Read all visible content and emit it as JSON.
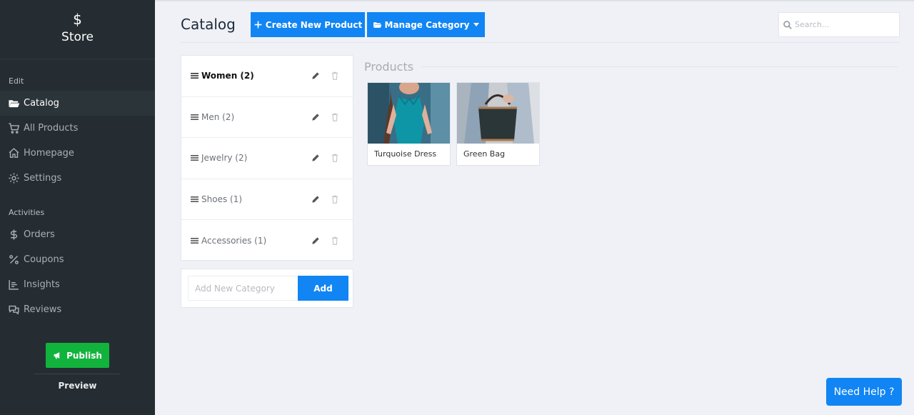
{
  "sidebar": {
    "brand_icon": "$",
    "brand_name": "Store",
    "edit_label": "Edit",
    "edit_items": [
      {
        "label": "Catalog",
        "icon": "folder-open-icon"
      },
      {
        "label": "All Products",
        "icon": "cart-icon"
      },
      {
        "label": "Homepage",
        "icon": "home-icon"
      },
      {
        "label": "Settings",
        "icon": "gear-icon"
      }
    ],
    "activities_label": "Activities",
    "activity_items": [
      {
        "label": "Orders",
        "icon": "dollar-icon"
      },
      {
        "label": "Coupons",
        "icon": "percent-icon"
      },
      {
        "label": "Insights",
        "icon": "bar-chart-icon"
      },
      {
        "label": "Reviews",
        "icon": "comments-icon"
      }
    ],
    "publish_label": "Publish",
    "preview_label": "Preview"
  },
  "header": {
    "title": "Catalog",
    "create_label": "Create New Product",
    "manage_label": "Manage Category",
    "search_placeholder": "Search..."
  },
  "categories": [
    {
      "label": "Women (2)",
      "active": true
    },
    {
      "label": "Men (2)",
      "active": false
    },
    {
      "label": "Jewelry (2)",
      "active": false
    },
    {
      "label": "Shoes (1)",
      "active": false
    },
    {
      "label": "Accessories (1)",
      "active": false
    }
  ],
  "add_category": {
    "placeholder": "Add New Category",
    "button_label": "Add"
  },
  "products": {
    "heading": "Products",
    "items": [
      {
        "name": "Turquoise Dress"
      },
      {
        "name": "Green Bag"
      }
    ]
  },
  "help_label": "Need Help ?",
  "colors": {
    "sidebar_bg": "#252d32",
    "accent_blue": "#1185f3",
    "publish_green": "#12b33c",
    "page_bg": "#eff1f6"
  }
}
